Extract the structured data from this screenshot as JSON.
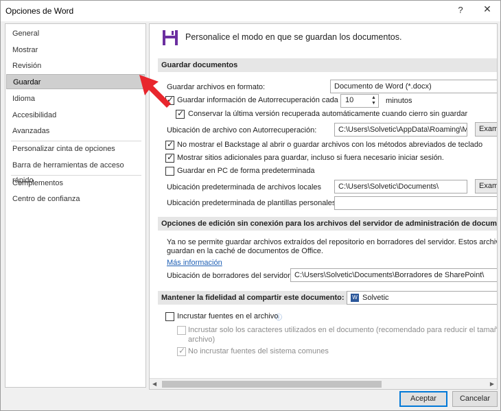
{
  "window": {
    "title": "Opciones de Word",
    "help": "?",
    "close": "✕"
  },
  "nav": {
    "items": [
      "General",
      "Mostrar",
      "Revisión",
      "Guardar",
      "Idioma",
      "Accesibilidad",
      "Avanzadas",
      "Personalizar cinta de opciones",
      "Barra de herramientas de acceso rápido",
      "Complementos",
      "Centro de confianza"
    ],
    "selected": "Guardar"
  },
  "header": {
    "text": "Personalice el modo en que se guardan los documentos."
  },
  "save_docs": {
    "section": "Guardar documentos",
    "format_label": "Guardar archivos en formato:",
    "format_value": "Documento de Word (*.docx)",
    "autorecover_label": "Guardar información de Autorrecuperación cada",
    "autorecover_checked": true,
    "autorecover_minutes": "10",
    "minutes_label": "minutos",
    "keep_last_label": "Conservar la última versión recuperada automáticamente cuando cierro sin guardar",
    "keep_last_checked": true,
    "autorecover_location_label": "Ubicación de archivo con Autorrecuperación:",
    "autorecover_location_value": "C:\\Users\\Solvetic\\AppData\\Roaming\\Mic",
    "browse_label": "Exam",
    "no_backstage_label": "No mostrar el Backstage al abrir o guardar archivos con los métodos abreviados de teclado",
    "no_backstage_checked": true,
    "more_places_label": "Mostrar sitios adicionales para guardar, incluso si fuera necesario iniciar sesión.",
    "more_places_checked": true,
    "save_pc_label": "Guardar en PC de forma predeterminada",
    "save_pc_checked": false,
    "local_location_label": "Ubicación predeterminada de archivos locales",
    "local_location_value": "C:\\Users\\Solvetic\\Documents\\",
    "browse2_label": "Exam",
    "templates_label": "Ubicación predeterminada de plantillas personales:",
    "templates_value": ""
  },
  "offline": {
    "section": "Opciones de edición sin conexión para los archivos del servidor de administración de documentos",
    "desc_line1": "Ya no se permite guardar archivos extraídos del repositorio en borradores del servidor. Estos archivos ahe",
    "desc_line2": "guardan en la caché de documentos de Office.",
    "more_info": "Más información",
    "drafts_label": "Ubicación de borradores del servidor:",
    "drafts_value": "C:\\Users\\Solvetic\\Documents\\Borradores de SharePoint\\"
  },
  "fidelity": {
    "section": "Mantener la fidelidad al compartir este documento:",
    "doc_value": "Solvetic",
    "embed_fonts_label": "Incrustar fuentes en el archivo",
    "embed_fonts_checked": false,
    "embed_chars_line1": "Incrustar solo los caracteres utilizados en el documento (recomendado para reducir el tamaño de",
    "embed_chars_line2": "archivo)",
    "no_system_fonts_label": "No incrustar fuentes del sistema comunes",
    "info_icon": "ⓘ"
  },
  "footer": {
    "ok": "Aceptar",
    "cancel": "Cancelar"
  },
  "colors": {
    "accent_arrow": "#e8262d",
    "selected_nav": "#cfcfcf",
    "section_bg": "#e6e6e6",
    "link": "#1e5fb4"
  }
}
